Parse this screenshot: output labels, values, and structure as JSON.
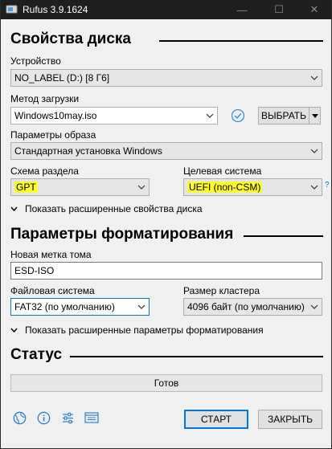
{
  "window": {
    "title": "Rufus 3.9.1624",
    "min_glyph": "—",
    "max_glyph": "☐",
    "close_glyph": "✕"
  },
  "drive_properties": {
    "heading": "Свойства диска",
    "device_label": "Устройство",
    "device_value": "NO_LABEL (D:) [8 Г6]",
    "boot_label": "Метод загрузки",
    "boot_value": "Windows10may.iso",
    "select_button": "ВЫБРАТЬ",
    "image_options_label": "Параметры образа",
    "image_options_value": "Стандартная установка Windows",
    "partition_label": "Схема раздела",
    "partition_value": "GPT",
    "target_label": "Целевая система",
    "target_value": "UEFI (non-CSM)",
    "help": "?",
    "advanced_toggle": "Показать расширенные свойства диска"
  },
  "format_options": {
    "heading": "Параметры форматирования",
    "volume_label_label": "Новая метка тома",
    "volume_label_value": "ESD-ISO",
    "filesystem_label": "Файловая система",
    "filesystem_value": "FAT32 (по умолчанию)",
    "cluster_label": "Размер кластера",
    "cluster_value": "4096 байт (по умолчанию)",
    "advanced_toggle": "Показать расширенные параметры форматирования"
  },
  "status": {
    "heading": "Статус",
    "text": "Готов"
  },
  "actions": {
    "start": "СТАРТ",
    "close": "ЗАКРЫТЬ"
  },
  "colors": {
    "highlight": "#ffff2e",
    "accent": "#0078d7",
    "titlebar": "#1f1f1f"
  },
  "toolbar_icons": [
    "globe-icon",
    "info-icon",
    "settings-sliders-icon",
    "log-icon"
  ]
}
